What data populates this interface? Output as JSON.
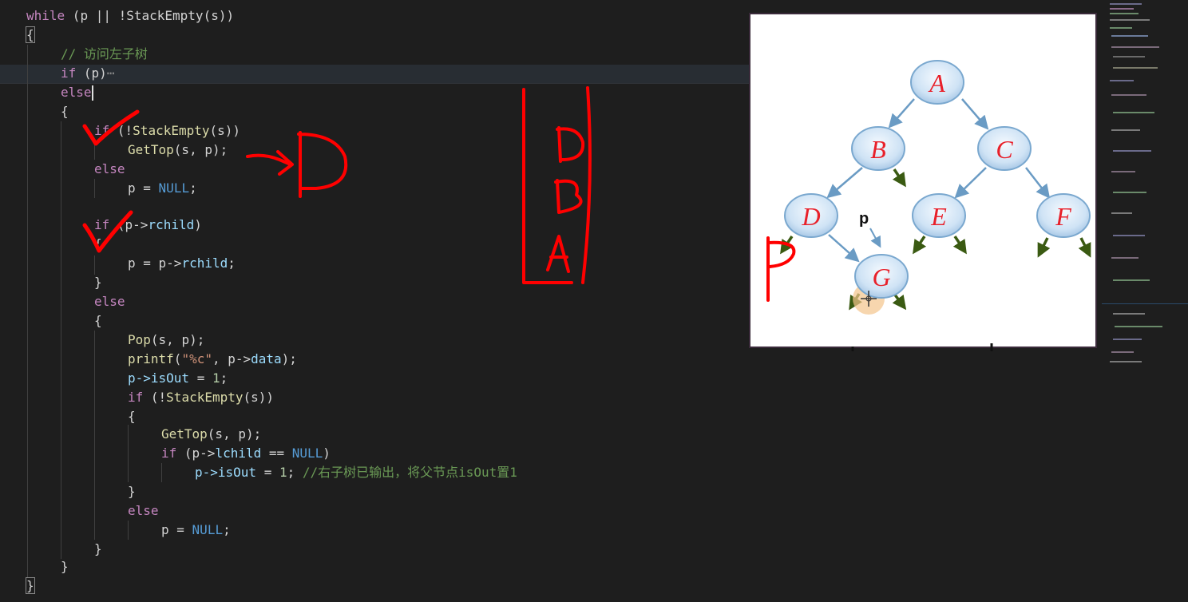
{
  "editor": {
    "lines": {
      "l1": {
        "kw": "while",
        "rest": " (p || !StackEmpty(s))"
      },
      "l2": {
        "text": "{"
      },
      "l3": {
        "comment": "// 访问左子树"
      },
      "l4": {
        "kw": "if",
        "rest": " (p)",
        "fold": "⋯"
      },
      "l5": {
        "kw": "else"
      },
      "l6": {
        "text": "{"
      },
      "l7": {
        "kw": "if",
        "open": " (!",
        "fn": "StackEmpty",
        "close": "(s))"
      },
      "l8": {
        "fn": "GetTop",
        "args": "(s, p);"
      },
      "l9": {
        "kw": "else"
      },
      "l10": {
        "var": "p",
        "op": " = ",
        "const": "NULL",
        "end": ";"
      },
      "l11": {
        "kw": "if",
        "open": " (p->",
        "var": "rchild",
        "close": ")"
      },
      "l12": {
        "text": "{"
      },
      "l13": {
        "var": "p",
        "op": " = p->",
        "var2": "rchild",
        "end": ";"
      },
      "l14": {
        "text": "}"
      },
      "l15": {
        "kw": "else"
      },
      "l16": {
        "text": "{"
      },
      "l17": {
        "fn": "Pop",
        "args": "(s, p);"
      },
      "l18": {
        "fn": "printf",
        "open": "(",
        "str": "\"%c\"",
        "close": ", p->",
        "var": "data",
        "end": ");"
      },
      "l19": {
        "var": "p->isOut",
        "op": " = ",
        "num": "1",
        "end": ";"
      },
      "l20": {
        "kw": "if",
        "open": " (!",
        "fn": "StackEmpty",
        "close": "(s))"
      },
      "l21": {
        "text": "{"
      },
      "l22": {
        "fn": "GetTop",
        "args": "(s, p);"
      },
      "l23": {
        "kw": "if",
        "open": " (p->",
        "var": "lchild",
        "op": " == ",
        "const": "NULL",
        "close": ")"
      },
      "l24": {
        "var": "p->isOut",
        "op": " = ",
        "num": "1",
        "end": "; ",
        "comment": "//右子树已输出，将父节点isOut置1"
      },
      "l25": {
        "text": "}"
      },
      "l26": {
        "kw": "else"
      },
      "l27": {
        "var": "p",
        "op": " = ",
        "const": "NULL",
        "end": ";"
      },
      "l28": {
        "text": "}"
      },
      "l29": {
        "text": "}"
      },
      "l30": {
        "text": "}"
      }
    }
  },
  "tree": {
    "nodes": [
      "A",
      "B",
      "C",
      "D",
      "E",
      "F",
      "G"
    ],
    "pointer_label": "p"
  },
  "annotations": {
    "stack_items": [
      "D",
      "B",
      "A"
    ],
    "arrow_target": "D",
    "side_letter": "P"
  },
  "colors": {
    "background": "#1e1e1e",
    "annotation": "#ff0000",
    "node_fill": "#d6e8f7",
    "node_text": "#e8202a",
    "edge": "#6a9bc4",
    "null_arrow": "#3a5a12"
  }
}
